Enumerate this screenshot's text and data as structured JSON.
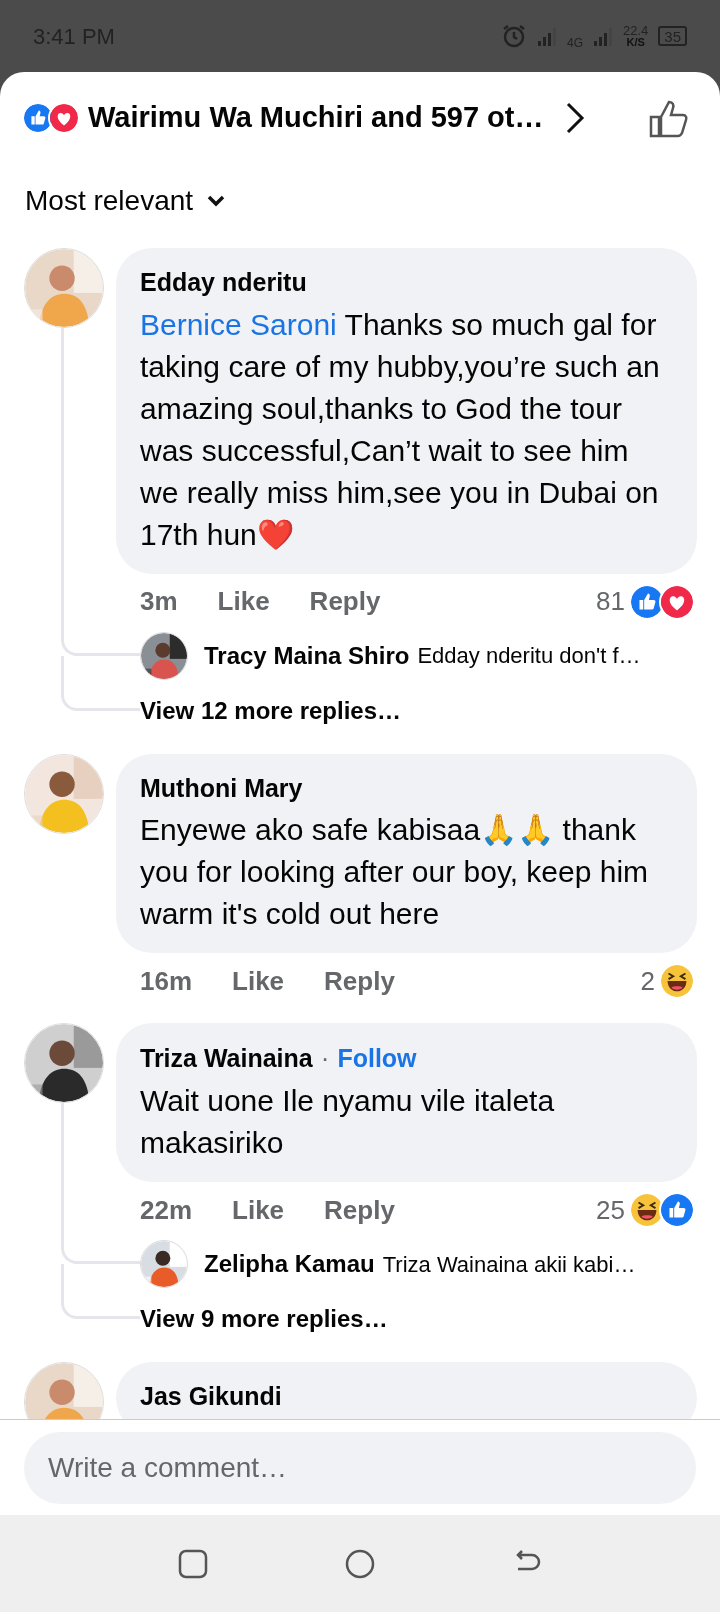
{
  "status_bar": {
    "time": "3:41 PM",
    "network": "4G",
    "speed": "22.4",
    "speed_unit": "K/S",
    "battery": "35"
  },
  "header": {
    "reactions": [
      {
        "kind": "like"
      },
      {
        "kind": "love"
      }
    ],
    "title": "Wairimu Wa Muchiri and 597 ot…"
  },
  "sort": {
    "label": "Most relevant"
  },
  "comments": [
    {
      "author": "Edday nderitu",
      "mention": "Bernice Saroni",
      "text": " Thanks so much gal for taking care of my hubby,you’re such an amazing soul,thanks to God the tour was successful,Can’t wait to see him we really miss him,see you in Dubai on 17th hun❤️",
      "time": "3m",
      "like": "Like",
      "reply": "Reply",
      "count": "81",
      "reactions": [
        {
          "kind": "like"
        },
        {
          "kind": "love"
        }
      ],
      "replies": [
        {
          "author": "Tracy Maina Shiro",
          "text": "Edday nderitu don't f…"
        }
      ],
      "more": "View 12 more replies…"
    },
    {
      "author": "Muthoni Mary",
      "text": "Enyewe ako safe kabisaa🙏🙏 thank you for looking after our boy, keep him warm it's cold out here",
      "time": "16m",
      "like": "Like",
      "reply": "Reply",
      "count": "2",
      "reactions": [
        {
          "kind": "haha"
        }
      ]
    },
    {
      "author": "Triza Wainaina",
      "separator": "·",
      "follow": "Follow",
      "text": "Wait uone Ile nyamu vile italeta makasiriko",
      "time": "22m",
      "like": "Like",
      "reply": "Reply",
      "count": "25",
      "reactions": [
        {
          "kind": "haha"
        },
        {
          "kind": "like"
        }
      ],
      "replies": [
        {
          "author": "Zelipha Kamau",
          "text": "Triza Wainaina akii kabi…"
        }
      ],
      "more": "View 9 more replies…"
    },
    {
      "author": "Jas Gikundi"
    }
  ],
  "composer": {
    "placeholder": "Write a comment…"
  }
}
